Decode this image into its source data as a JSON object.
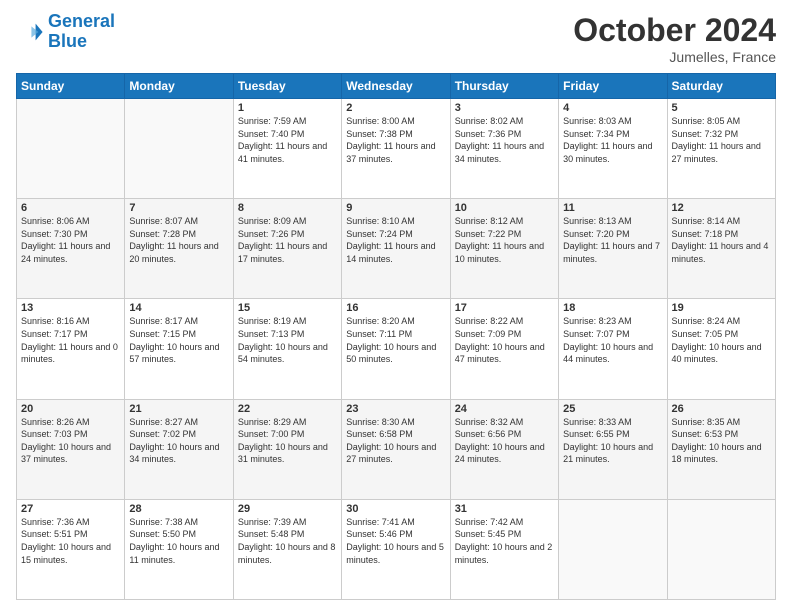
{
  "logo": {
    "line1": "General",
    "line2": "Blue"
  },
  "header": {
    "month": "October 2024",
    "location": "Jumelles, France"
  },
  "weekdays": [
    "Sunday",
    "Monday",
    "Tuesday",
    "Wednesday",
    "Thursday",
    "Friday",
    "Saturday"
  ],
  "weeks": [
    [
      null,
      null,
      {
        "day": 1,
        "sunrise": "7:59 AM",
        "sunset": "7:40 PM",
        "daylight": "11 hours and 41 minutes."
      },
      {
        "day": 2,
        "sunrise": "8:00 AM",
        "sunset": "7:38 PM",
        "daylight": "11 hours and 37 minutes."
      },
      {
        "day": 3,
        "sunrise": "8:02 AM",
        "sunset": "7:36 PM",
        "daylight": "11 hours and 34 minutes."
      },
      {
        "day": 4,
        "sunrise": "8:03 AM",
        "sunset": "7:34 PM",
        "daylight": "11 hours and 30 minutes."
      },
      {
        "day": 5,
        "sunrise": "8:05 AM",
        "sunset": "7:32 PM",
        "daylight": "11 hours and 27 minutes."
      }
    ],
    [
      {
        "day": 6,
        "sunrise": "8:06 AM",
        "sunset": "7:30 PM",
        "daylight": "11 hours and 24 minutes."
      },
      {
        "day": 7,
        "sunrise": "8:07 AM",
        "sunset": "7:28 PM",
        "daylight": "11 hours and 20 minutes."
      },
      {
        "day": 8,
        "sunrise": "8:09 AM",
        "sunset": "7:26 PM",
        "daylight": "11 hours and 17 minutes."
      },
      {
        "day": 9,
        "sunrise": "8:10 AM",
        "sunset": "7:24 PM",
        "daylight": "11 hours and 14 minutes."
      },
      {
        "day": 10,
        "sunrise": "8:12 AM",
        "sunset": "7:22 PM",
        "daylight": "11 hours and 10 minutes."
      },
      {
        "day": 11,
        "sunrise": "8:13 AM",
        "sunset": "7:20 PM",
        "daylight": "11 hours and 7 minutes."
      },
      {
        "day": 12,
        "sunrise": "8:14 AM",
        "sunset": "7:18 PM",
        "daylight": "11 hours and 4 minutes."
      }
    ],
    [
      {
        "day": 13,
        "sunrise": "8:16 AM",
        "sunset": "7:17 PM",
        "daylight": "11 hours and 0 minutes."
      },
      {
        "day": 14,
        "sunrise": "8:17 AM",
        "sunset": "7:15 PM",
        "daylight": "10 hours and 57 minutes."
      },
      {
        "day": 15,
        "sunrise": "8:19 AM",
        "sunset": "7:13 PM",
        "daylight": "10 hours and 54 minutes."
      },
      {
        "day": 16,
        "sunrise": "8:20 AM",
        "sunset": "7:11 PM",
        "daylight": "10 hours and 50 minutes."
      },
      {
        "day": 17,
        "sunrise": "8:22 AM",
        "sunset": "7:09 PM",
        "daylight": "10 hours and 47 minutes."
      },
      {
        "day": 18,
        "sunrise": "8:23 AM",
        "sunset": "7:07 PM",
        "daylight": "10 hours and 44 minutes."
      },
      {
        "day": 19,
        "sunrise": "8:24 AM",
        "sunset": "7:05 PM",
        "daylight": "10 hours and 40 minutes."
      }
    ],
    [
      {
        "day": 20,
        "sunrise": "8:26 AM",
        "sunset": "7:03 PM",
        "daylight": "10 hours and 37 minutes."
      },
      {
        "day": 21,
        "sunrise": "8:27 AM",
        "sunset": "7:02 PM",
        "daylight": "10 hours and 34 minutes."
      },
      {
        "day": 22,
        "sunrise": "8:29 AM",
        "sunset": "7:00 PM",
        "daylight": "10 hours and 31 minutes."
      },
      {
        "day": 23,
        "sunrise": "8:30 AM",
        "sunset": "6:58 PM",
        "daylight": "10 hours and 27 minutes."
      },
      {
        "day": 24,
        "sunrise": "8:32 AM",
        "sunset": "6:56 PM",
        "daylight": "10 hours and 24 minutes."
      },
      {
        "day": 25,
        "sunrise": "8:33 AM",
        "sunset": "6:55 PM",
        "daylight": "10 hours and 21 minutes."
      },
      {
        "day": 26,
        "sunrise": "8:35 AM",
        "sunset": "6:53 PM",
        "daylight": "10 hours and 18 minutes."
      }
    ],
    [
      {
        "day": 27,
        "sunrise": "7:36 AM",
        "sunset": "5:51 PM",
        "daylight": "10 hours and 15 minutes."
      },
      {
        "day": 28,
        "sunrise": "7:38 AM",
        "sunset": "5:50 PM",
        "daylight": "10 hours and 11 minutes."
      },
      {
        "day": 29,
        "sunrise": "7:39 AM",
        "sunset": "5:48 PM",
        "daylight": "10 hours and 8 minutes."
      },
      {
        "day": 30,
        "sunrise": "7:41 AM",
        "sunset": "5:46 PM",
        "daylight": "10 hours and 5 minutes."
      },
      {
        "day": 31,
        "sunrise": "7:42 AM",
        "sunset": "5:45 PM",
        "daylight": "10 hours and 2 minutes."
      },
      null,
      null
    ]
  ]
}
